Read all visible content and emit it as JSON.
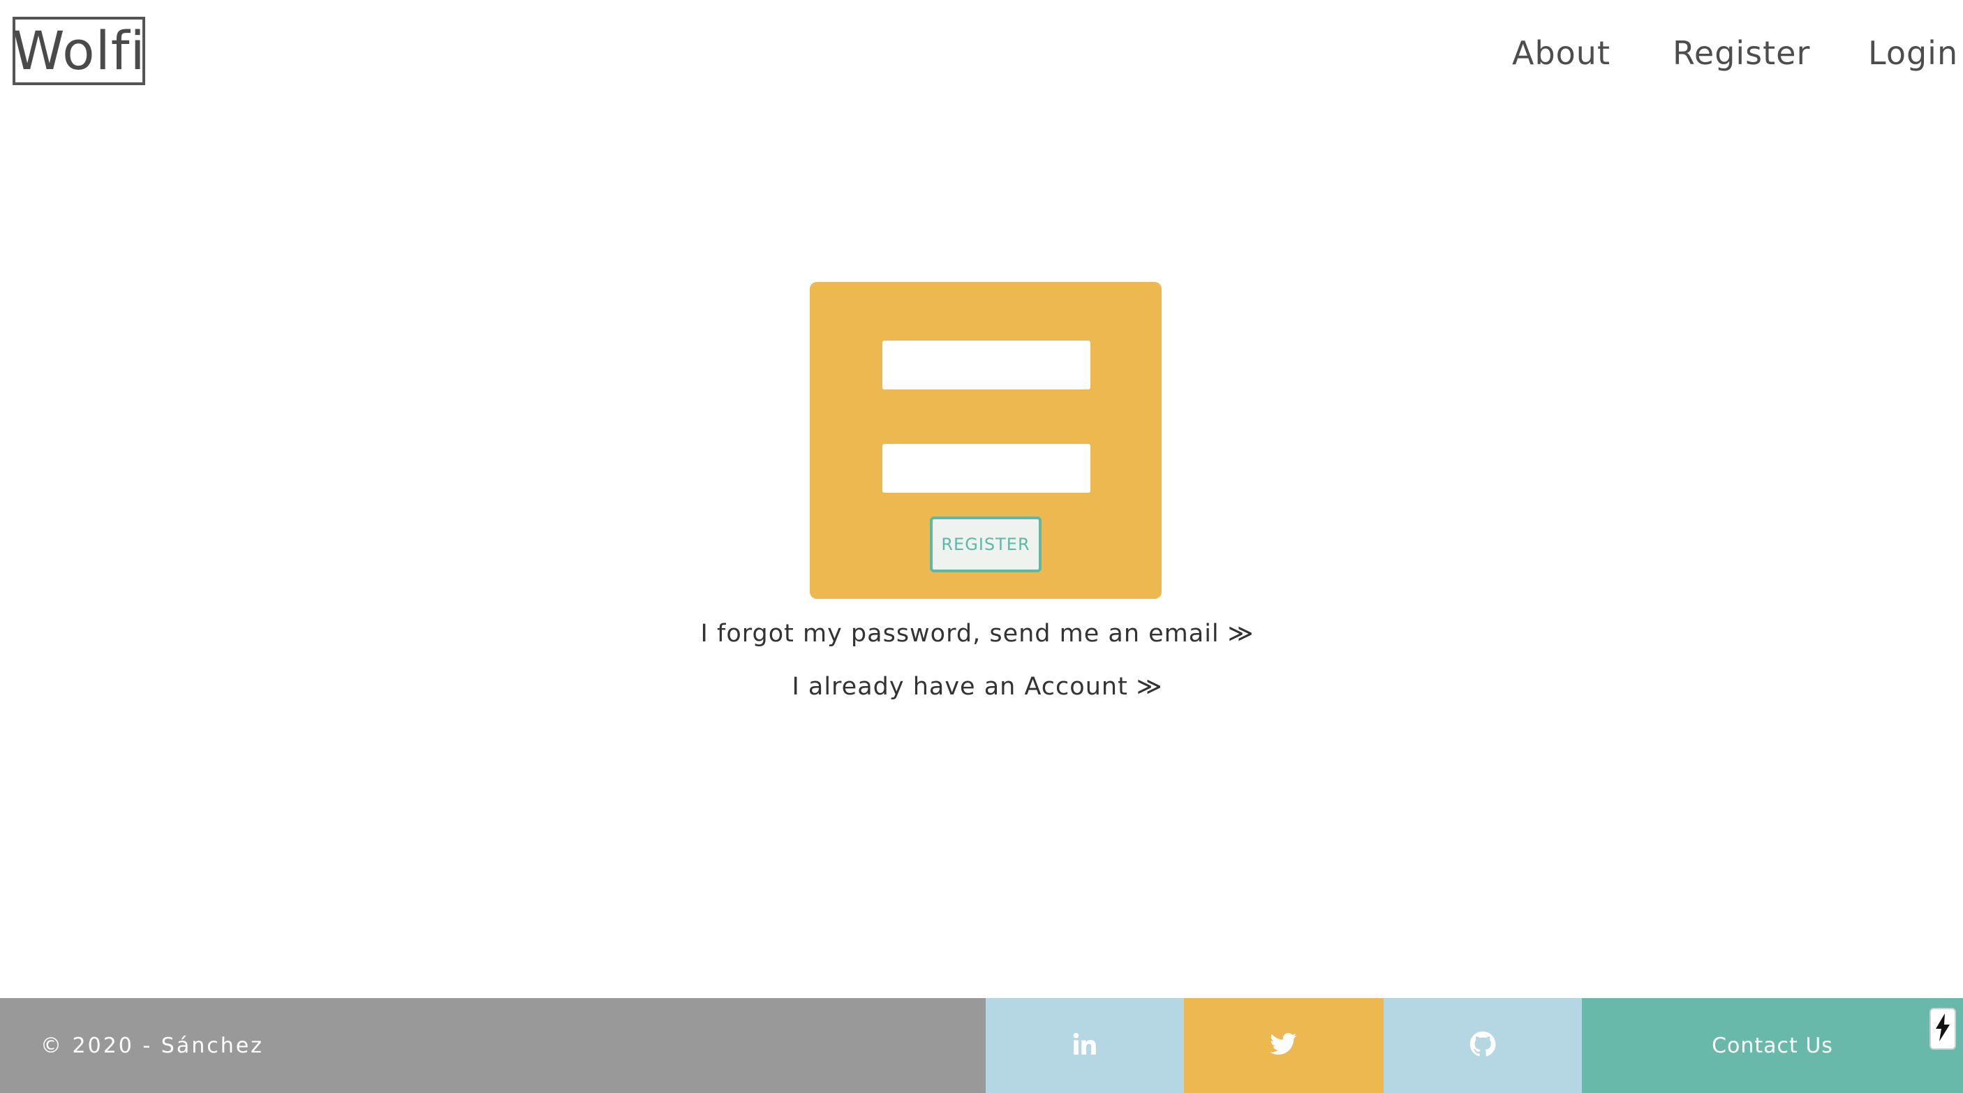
{
  "header": {
    "logo_text": "Wolfi",
    "nav": {
      "about": "About",
      "register": "Register",
      "login": "Login"
    }
  },
  "form": {
    "field1": {
      "value": "",
      "placeholder": ""
    },
    "field2": {
      "value": "",
      "placeholder": ""
    },
    "submit_label": "REGISTER"
  },
  "links": {
    "forgot": "I forgot my password, send me an email ≫",
    "account": "I already have an Account ≫"
  },
  "footer": {
    "copyright": "© 2020 - Sánchez",
    "contact_label": "Contact Us",
    "icons": [
      "linkedin-icon",
      "twitter-icon",
      "github-icon",
      "lightning-bolt-icon"
    ]
  },
  "colors": {
    "card": "#ecb84f",
    "accent": "#5fb7a6",
    "footer_gray": "#999999",
    "linkedin_bg": "#b5d7e3",
    "twitter_bg": "#ecb84f",
    "github_bg": "#b5d7e3",
    "contact_bg": "#69b9aa",
    "text": "#4d4d4d"
  }
}
